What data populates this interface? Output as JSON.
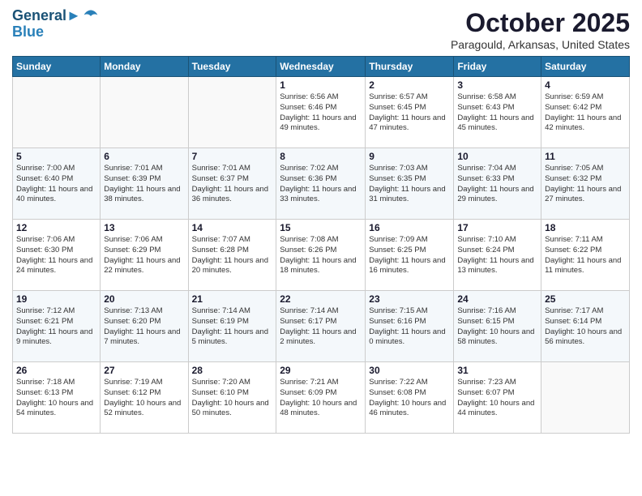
{
  "header": {
    "logo_line1": "General",
    "logo_line2": "Blue",
    "month_title": "October 2025",
    "location": "Paragould, Arkansas, United States"
  },
  "weekdays": [
    "Sunday",
    "Monday",
    "Tuesday",
    "Wednesday",
    "Thursday",
    "Friday",
    "Saturday"
  ],
  "weeks": [
    [
      {
        "day": "",
        "detail": ""
      },
      {
        "day": "",
        "detail": ""
      },
      {
        "day": "",
        "detail": ""
      },
      {
        "day": "1",
        "detail": "Sunrise: 6:56 AM\nSunset: 6:46 PM\nDaylight: 11 hours\nand 49 minutes."
      },
      {
        "day": "2",
        "detail": "Sunrise: 6:57 AM\nSunset: 6:45 PM\nDaylight: 11 hours\nand 47 minutes."
      },
      {
        "day": "3",
        "detail": "Sunrise: 6:58 AM\nSunset: 6:43 PM\nDaylight: 11 hours\nand 45 minutes."
      },
      {
        "day": "4",
        "detail": "Sunrise: 6:59 AM\nSunset: 6:42 PM\nDaylight: 11 hours\nand 42 minutes."
      }
    ],
    [
      {
        "day": "5",
        "detail": "Sunrise: 7:00 AM\nSunset: 6:40 PM\nDaylight: 11 hours\nand 40 minutes."
      },
      {
        "day": "6",
        "detail": "Sunrise: 7:01 AM\nSunset: 6:39 PM\nDaylight: 11 hours\nand 38 minutes."
      },
      {
        "day": "7",
        "detail": "Sunrise: 7:01 AM\nSunset: 6:37 PM\nDaylight: 11 hours\nand 36 minutes."
      },
      {
        "day": "8",
        "detail": "Sunrise: 7:02 AM\nSunset: 6:36 PM\nDaylight: 11 hours\nand 33 minutes."
      },
      {
        "day": "9",
        "detail": "Sunrise: 7:03 AM\nSunset: 6:35 PM\nDaylight: 11 hours\nand 31 minutes."
      },
      {
        "day": "10",
        "detail": "Sunrise: 7:04 AM\nSunset: 6:33 PM\nDaylight: 11 hours\nand 29 minutes."
      },
      {
        "day": "11",
        "detail": "Sunrise: 7:05 AM\nSunset: 6:32 PM\nDaylight: 11 hours\nand 27 minutes."
      }
    ],
    [
      {
        "day": "12",
        "detail": "Sunrise: 7:06 AM\nSunset: 6:30 PM\nDaylight: 11 hours\nand 24 minutes."
      },
      {
        "day": "13",
        "detail": "Sunrise: 7:06 AM\nSunset: 6:29 PM\nDaylight: 11 hours\nand 22 minutes."
      },
      {
        "day": "14",
        "detail": "Sunrise: 7:07 AM\nSunset: 6:28 PM\nDaylight: 11 hours\nand 20 minutes."
      },
      {
        "day": "15",
        "detail": "Sunrise: 7:08 AM\nSunset: 6:26 PM\nDaylight: 11 hours\nand 18 minutes."
      },
      {
        "day": "16",
        "detail": "Sunrise: 7:09 AM\nSunset: 6:25 PM\nDaylight: 11 hours\nand 16 minutes."
      },
      {
        "day": "17",
        "detail": "Sunrise: 7:10 AM\nSunset: 6:24 PM\nDaylight: 11 hours\nand 13 minutes."
      },
      {
        "day": "18",
        "detail": "Sunrise: 7:11 AM\nSunset: 6:22 PM\nDaylight: 11 hours\nand 11 minutes."
      }
    ],
    [
      {
        "day": "19",
        "detail": "Sunrise: 7:12 AM\nSunset: 6:21 PM\nDaylight: 11 hours\nand 9 minutes."
      },
      {
        "day": "20",
        "detail": "Sunrise: 7:13 AM\nSunset: 6:20 PM\nDaylight: 11 hours\nand 7 minutes."
      },
      {
        "day": "21",
        "detail": "Sunrise: 7:14 AM\nSunset: 6:19 PM\nDaylight: 11 hours\nand 5 minutes."
      },
      {
        "day": "22",
        "detail": "Sunrise: 7:14 AM\nSunset: 6:17 PM\nDaylight: 11 hours\nand 2 minutes."
      },
      {
        "day": "23",
        "detail": "Sunrise: 7:15 AM\nSunset: 6:16 PM\nDaylight: 11 hours\nand 0 minutes."
      },
      {
        "day": "24",
        "detail": "Sunrise: 7:16 AM\nSunset: 6:15 PM\nDaylight: 10 hours\nand 58 minutes."
      },
      {
        "day": "25",
        "detail": "Sunrise: 7:17 AM\nSunset: 6:14 PM\nDaylight: 10 hours\nand 56 minutes."
      }
    ],
    [
      {
        "day": "26",
        "detail": "Sunrise: 7:18 AM\nSunset: 6:13 PM\nDaylight: 10 hours\nand 54 minutes."
      },
      {
        "day": "27",
        "detail": "Sunrise: 7:19 AM\nSunset: 6:12 PM\nDaylight: 10 hours\nand 52 minutes."
      },
      {
        "day": "28",
        "detail": "Sunrise: 7:20 AM\nSunset: 6:10 PM\nDaylight: 10 hours\nand 50 minutes."
      },
      {
        "day": "29",
        "detail": "Sunrise: 7:21 AM\nSunset: 6:09 PM\nDaylight: 10 hours\nand 48 minutes."
      },
      {
        "day": "30",
        "detail": "Sunrise: 7:22 AM\nSunset: 6:08 PM\nDaylight: 10 hours\nand 46 minutes."
      },
      {
        "day": "31",
        "detail": "Sunrise: 7:23 AM\nSunset: 6:07 PM\nDaylight: 10 hours\nand 44 minutes."
      },
      {
        "day": "",
        "detail": ""
      }
    ]
  ]
}
